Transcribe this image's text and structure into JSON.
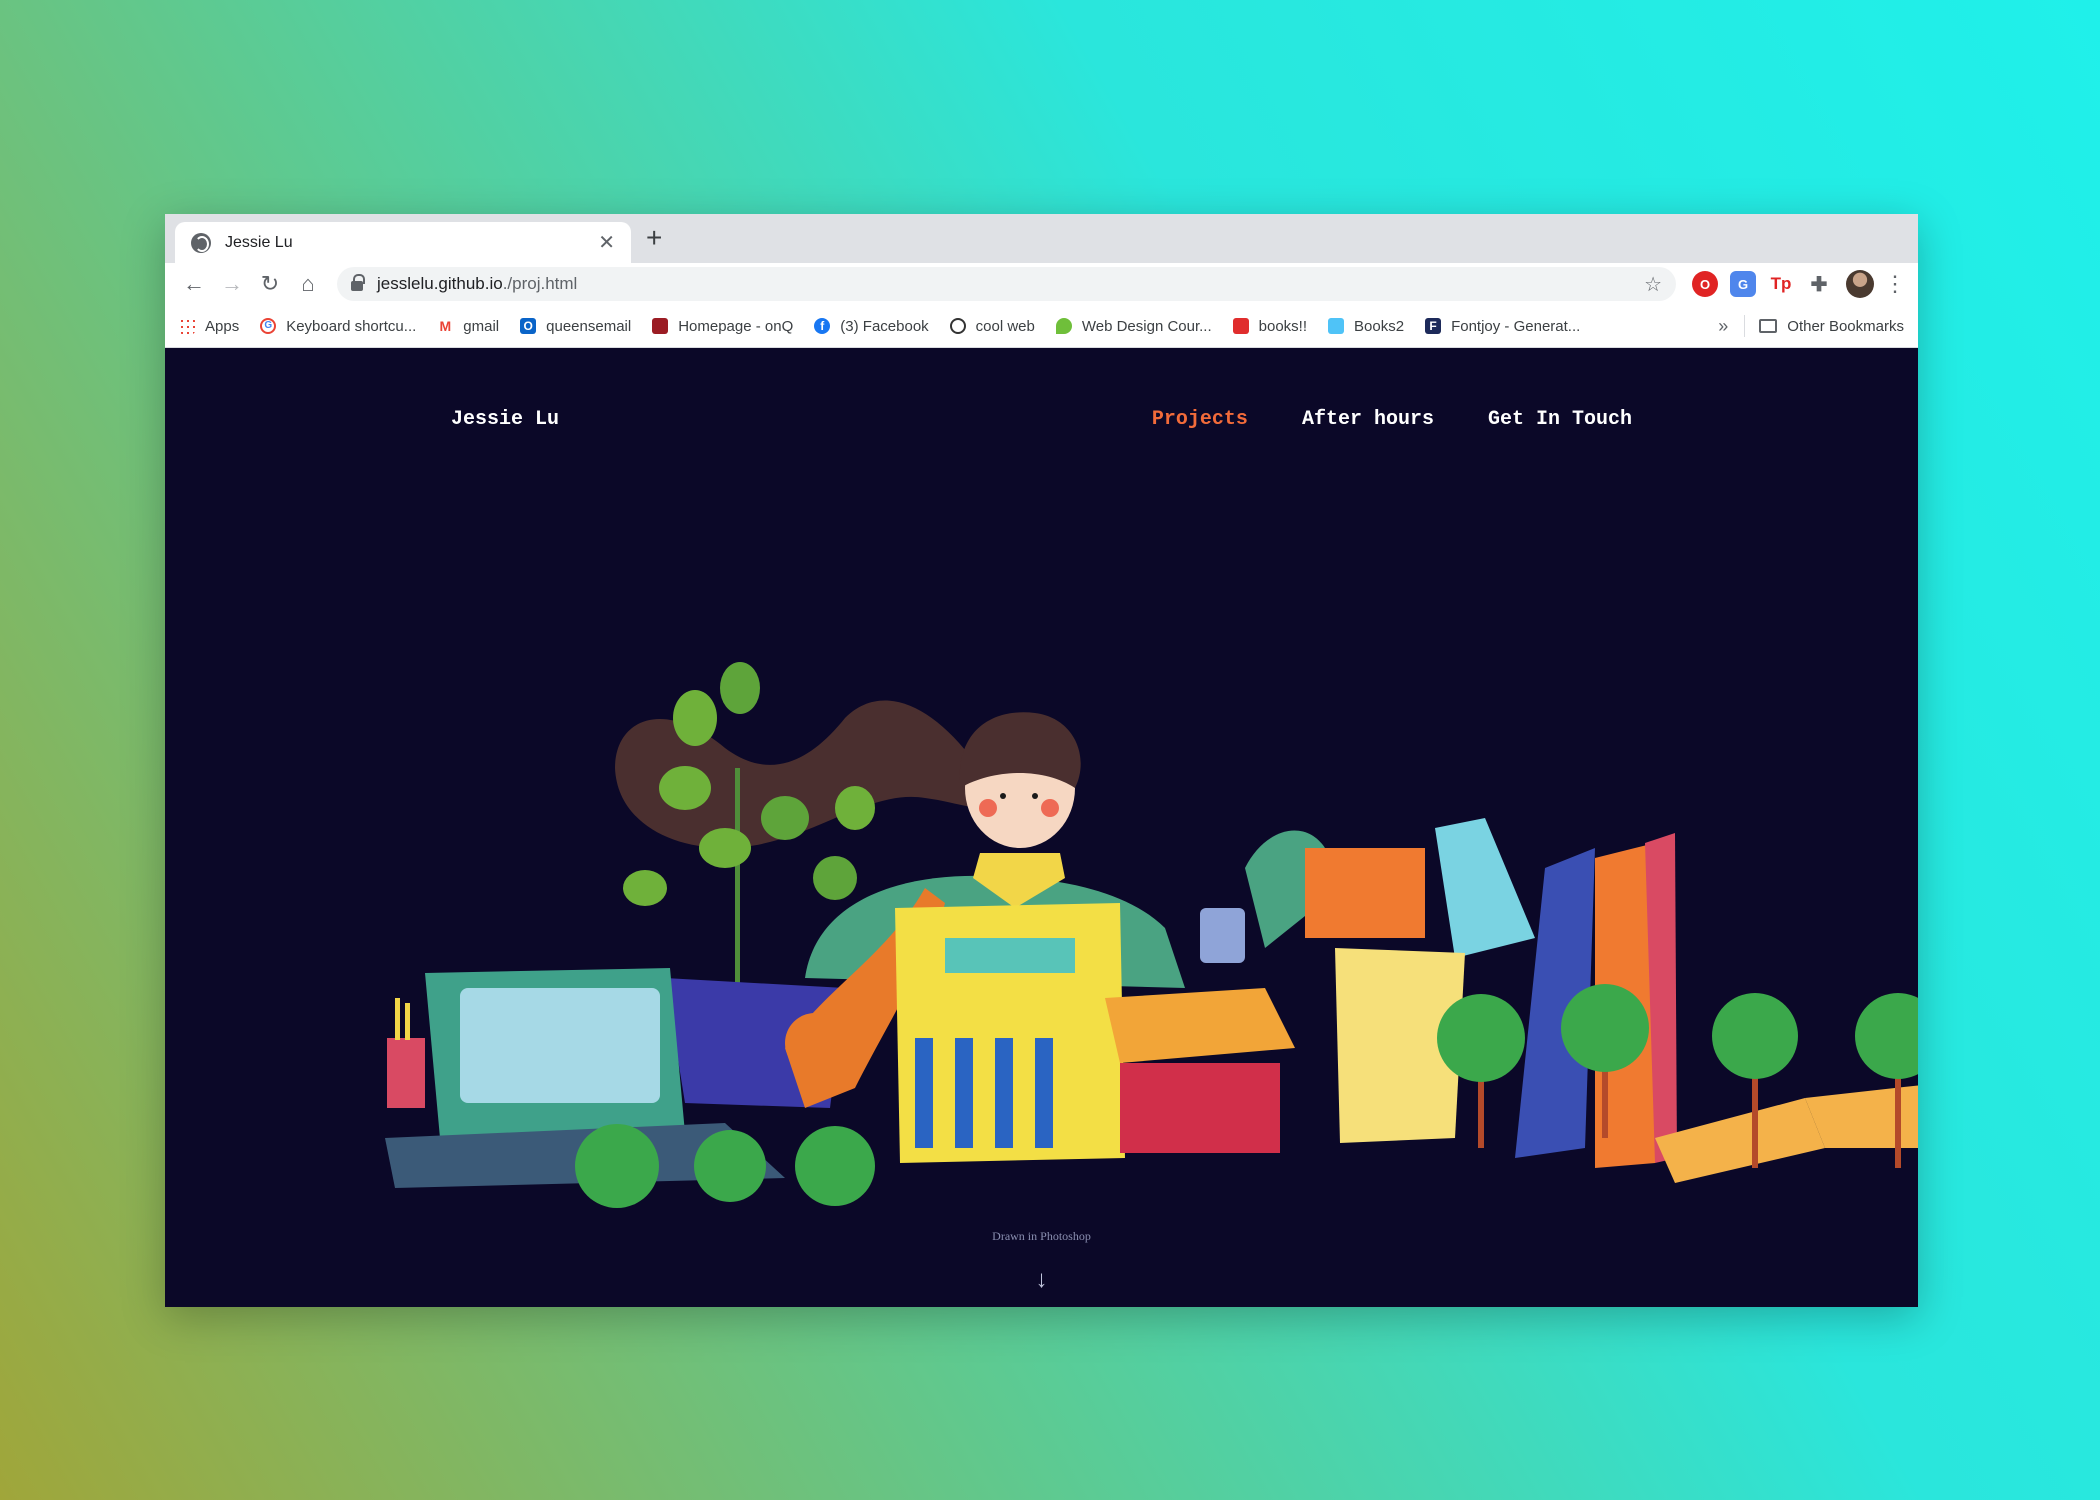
{
  "browser": {
    "tab_title": "Jessie Lu",
    "tab_close": "✕",
    "new_tab": "+",
    "url_host": "jesslelu.github.io",
    "url_path": "./proj.html",
    "bookmarks": [
      {
        "label": "Apps",
        "icon": "apps-icon"
      },
      {
        "label": "Keyboard shortcu...",
        "icon": "google-icon"
      },
      {
        "label": "gmail",
        "icon": "gmail-icon"
      },
      {
        "label": "queensemail",
        "icon": "outlook-icon"
      },
      {
        "label": "Homepage - onQ",
        "icon": "queens-crest-icon"
      },
      {
        "label": "(3) Facebook",
        "icon": "facebook-icon"
      },
      {
        "label": "cool web",
        "icon": "cool-web-icon"
      },
      {
        "label": "Web Design Cour...",
        "icon": "web-design-icon"
      },
      {
        "label": "books!!",
        "icon": "books-icon"
      },
      {
        "label": "Books2",
        "icon": "books2-icon"
      },
      {
        "label": "Fontjoy - Generat...",
        "icon": "fontjoy-icon"
      }
    ],
    "other_bookmarks": "Other Bookmarks",
    "overflow": "»"
  },
  "site": {
    "name": "Jessie Lu",
    "nav": [
      "Projects",
      "After hours",
      "Get In Touch"
    ],
    "active_nav": "Projects",
    "caption": "Drawn in Photoshop",
    "down_arrow": "↓"
  },
  "colors": {
    "page_bg": "#0b0828",
    "nav_active": "#f26b3a",
    "nav_text": "#ffffff"
  }
}
